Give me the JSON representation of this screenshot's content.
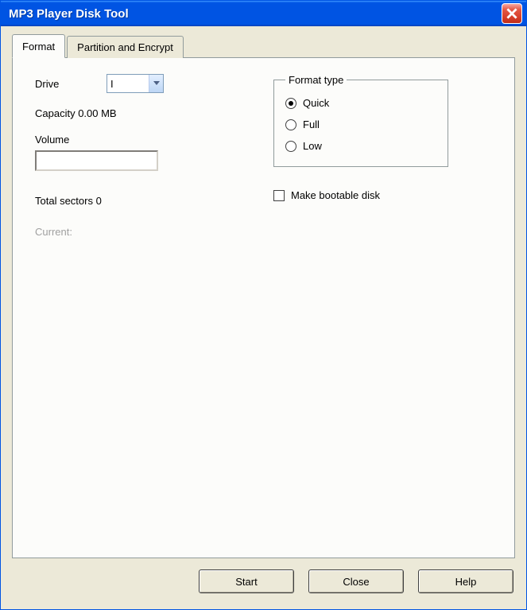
{
  "window": {
    "title": "MP3 Player Disk Tool"
  },
  "tabs": {
    "format": "Format",
    "partition": "Partition and Encrypt"
  },
  "drive": {
    "label": "Drive",
    "value": "I"
  },
  "capacity": {
    "text": "Capacity 0.00 MB"
  },
  "volume": {
    "label": "Volume",
    "value": ""
  },
  "sectors": {
    "text": "Total sectors 0"
  },
  "current": {
    "label": "Current:"
  },
  "format_type": {
    "legend": "Format type",
    "quick": "Quick",
    "full": "Full",
    "low": "Low",
    "selected": "quick"
  },
  "bootable": {
    "label": "Make bootable disk"
  },
  "buttons": {
    "start": "Start",
    "close": "Close",
    "help": "Help"
  }
}
